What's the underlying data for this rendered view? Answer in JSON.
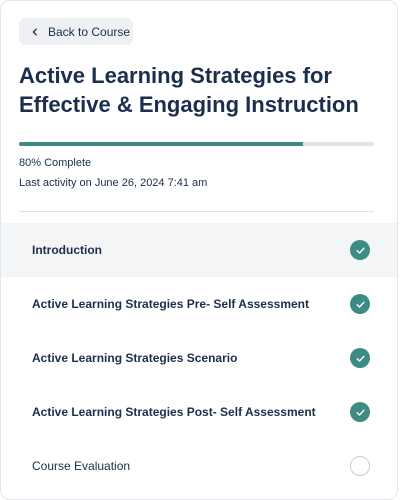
{
  "nav": {
    "back_label": "Back to Course"
  },
  "course": {
    "title": "Active Learning Strategies for Effective & Engaging Instruction",
    "progress_percent": 80,
    "progress_label": "80% Complete",
    "last_activity": "Last activity on June 26, 2024 7:41 am"
  },
  "lessons": [
    {
      "title": "Introduction",
      "completed": true
    },
    {
      "title": "Active Learning Strategies Pre- Self Assessment",
      "completed": true
    },
    {
      "title": "Active Learning Strategies Scenario",
      "completed": true
    },
    {
      "title": "Active Learning Strategies Post- Self Assessment",
      "completed": true
    },
    {
      "title": "Course Evaluation",
      "completed": false
    }
  ],
  "colors": {
    "accent": "#3d8b82",
    "text": "#1c2d4d",
    "track": "#e1e3e7"
  },
  "icons": {
    "back": "chevron-left-icon",
    "complete": "check-circle-icon",
    "incomplete": "empty-circle-icon"
  }
}
